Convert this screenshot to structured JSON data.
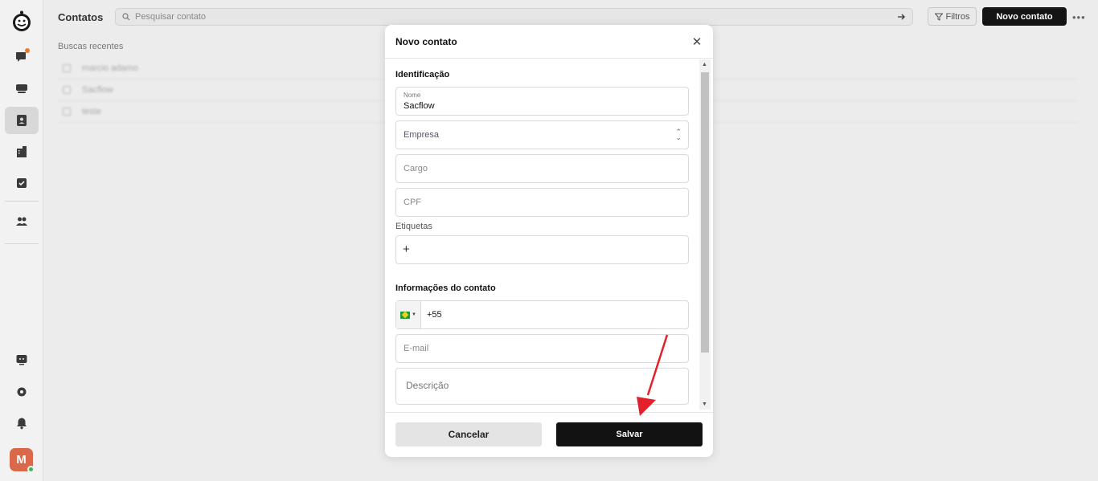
{
  "header": {
    "title": "Contatos",
    "search_placeholder": "Pesquisar contato",
    "filters_label": "Filtros",
    "new_contact_label": "Novo contato"
  },
  "recent": {
    "title": "Buscas recentes",
    "items": [
      "marcio adamo",
      "Sacflow",
      "teste"
    ]
  },
  "sidebar": {
    "avatar_initial": "M",
    "icons": [
      "logo-icon",
      "chat-icon",
      "inbox-icon",
      "contacts-icon",
      "companies-icon",
      "tasks-icon",
      "team-icon",
      "support-icon",
      "settings-icon",
      "bell-icon"
    ]
  },
  "modal": {
    "title": "Novo contato",
    "section_identification": "Identificação",
    "name_label": "Nome",
    "name_value": "Sacflow",
    "company_placeholder": "Empresa",
    "role_placeholder": "Cargo",
    "cpf_placeholder": "CPF",
    "tags_label": "Etiquetas",
    "tags_add": "+",
    "section_contact": "Informações do contato",
    "phone_prefix": "+55",
    "email_placeholder": "E-mail",
    "description_placeholder": "Descrição",
    "cancel_label": "Cancelar",
    "save_label": "Salvar"
  },
  "colors": {
    "accent_dark": "#121212",
    "notification_dot": "#e87a2a",
    "avatar_bg": "#d9694a",
    "online": "#3cb55e",
    "annotation_arrow": "#e3212b"
  }
}
